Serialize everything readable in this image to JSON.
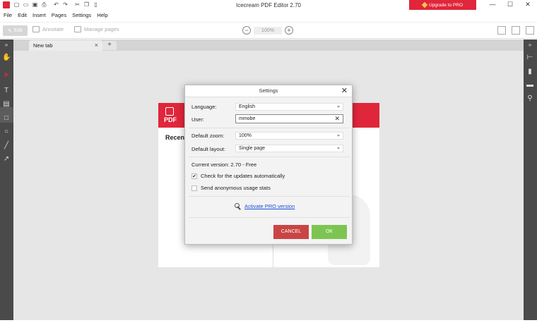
{
  "window": {
    "title": "Icecream PDF Editor 2.70",
    "upgrade_label": "Upgrade to PRO",
    "minimize": "—",
    "maximize": "☐",
    "close": "✕"
  },
  "menu": [
    "File",
    "Edit",
    "Insert",
    "Pages",
    "Settings",
    "Help"
  ],
  "toolbar": {
    "edit_label": "Edit",
    "annotate_label": "Annotate",
    "manage_pages_label": "Manage pages",
    "zoom_value": "100%",
    "zoom_out": "−",
    "zoom_in": "+"
  },
  "tabs": {
    "active_label": "New tab",
    "close_glyph": "×",
    "add_glyph": "+"
  },
  "start_page": {
    "logo_text": "PDF",
    "recent_heading": "Recent"
  },
  "dialog": {
    "title": "Settings",
    "close_glyph": "✕",
    "language_label": "Language:",
    "language_value": "English",
    "user_label": "User:",
    "user_value": "mmobe",
    "user_clear": "✕",
    "default_zoom_label": "Default zoom:",
    "default_zoom_value": "100%",
    "default_layout_label": "Default layout:",
    "default_layout_value": "Single page",
    "current_version": "Current version: 2.70 - Free",
    "check_updates_label": "Check for the updates automatically",
    "check_updates_checked": true,
    "check_mark": "✔",
    "anon_stats_label": "Send anonymous usage stats",
    "anon_stats_checked": false,
    "activate_label": "Activate PRO version",
    "cancel_label": "CANCEL",
    "ok_label": "OK"
  },
  "colors": {
    "brand_red": "#e0263a",
    "cancel_red": "#c94545",
    "ok_green": "#7dc552",
    "link_blue": "#1a4fd6"
  }
}
